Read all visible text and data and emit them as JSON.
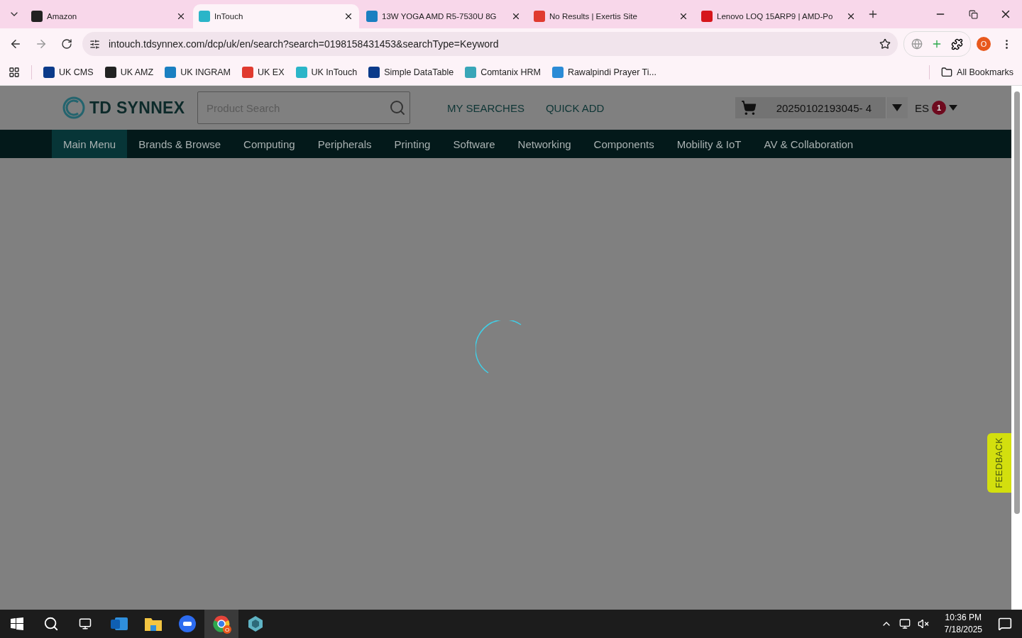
{
  "browser": {
    "tabs": [
      {
        "title": "Amazon",
        "selected": false,
        "color": "#222222"
      },
      {
        "title": "InTouch",
        "selected": true,
        "color": "#2bb5c8"
      },
      {
        "title": "13W YOGA AMD R5-7530U 8G",
        "selected": false,
        "color": "#1a7fc1"
      },
      {
        "title": "No Results | Exertis Site",
        "selected": false,
        "color": "#e03a2f"
      },
      {
        "title": "Lenovo LOQ 15ARP9 | AMD-Po",
        "selected": false,
        "color": "#d6161c"
      }
    ],
    "url": "intouch.tdsynnex.com/dcp/uk/en/search?search=0198158431453&searchType=Keyword",
    "profile": "O",
    "bookmarks": [
      {
        "label": "UK CMS",
        "color": "#0b3a8a"
      },
      {
        "label": "UK AMZ",
        "color": "#222222"
      },
      {
        "label": "UK INGRAM",
        "color": "#1a7fc1"
      },
      {
        "label": "UK EX",
        "color": "#e03a2f"
      },
      {
        "label": "UK InTouch",
        "color": "#2bb5c8"
      },
      {
        "label": "Simple DataTable",
        "color": "#0b3a8a"
      },
      {
        "label": "Comtanix HRM",
        "color": "#39a6b8"
      },
      {
        "label": "Rawalpindi Prayer Ti...",
        "color": "#2a8bd6"
      }
    ],
    "all_bookmarks": "All Bookmarks"
  },
  "site": {
    "logo": "TD SYNNEX",
    "search": {
      "placeholder": "Product Search"
    },
    "links": [
      "MY SEARCHES",
      "QUICK ADD"
    ],
    "cart": "20250102193045- 4",
    "user": "ES",
    "notifications": "1",
    "nav": [
      {
        "label": "Main Menu",
        "selected": true
      },
      {
        "label": "Brands & Browse",
        "selected": false
      },
      {
        "label": "Computing",
        "selected": false
      },
      {
        "label": "Peripherals",
        "selected": false
      },
      {
        "label": "Printing",
        "selected": false
      },
      {
        "label": "Software",
        "selected": false
      },
      {
        "label": "Networking",
        "selected": false
      },
      {
        "label": "Components",
        "selected": false
      },
      {
        "label": "Mobility & IoT",
        "selected": false
      },
      {
        "label": "AV & Collaboration",
        "selected": false
      }
    ],
    "feedback": "FEEDBACK"
  },
  "taskbar": {
    "chrome_badge": "O",
    "time": "10:36 PM",
    "date": "7/18/2025"
  }
}
